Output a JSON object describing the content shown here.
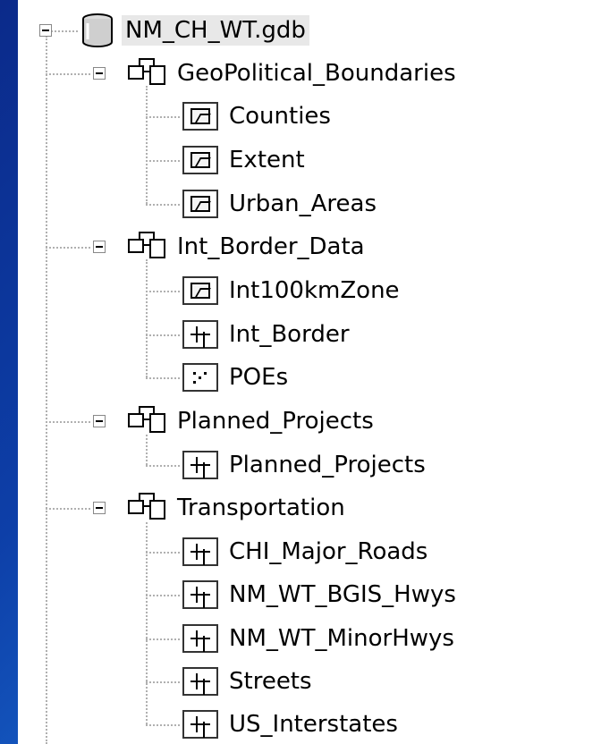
{
  "tree": {
    "root": {
      "label": "NM_CH_WT.gdb",
      "icon": "database-icon"
    },
    "datasets": [
      {
        "label": "GeoPolitical_Boundaries",
        "icon": "feature-dataset-icon",
        "classes": [
          {
            "label": "Counties",
            "type": "polygon"
          },
          {
            "label": "Extent",
            "type": "polygon"
          },
          {
            "label": "Urban_Areas",
            "type": "polygon"
          }
        ]
      },
      {
        "label": "Int_Border_Data",
        "icon": "feature-dataset-icon",
        "classes": [
          {
            "label": "Int100kmZone",
            "type": "polygon"
          },
          {
            "label": "Int_Border",
            "type": "line"
          },
          {
            "label": "POEs",
            "type": "point"
          }
        ]
      },
      {
        "label": "Planned_Projects",
        "icon": "feature-dataset-icon",
        "classes": [
          {
            "label": "Planned_Projects",
            "type": "line"
          }
        ]
      },
      {
        "label": "Transportation",
        "icon": "feature-dataset-icon",
        "classes": [
          {
            "label": "CHI_Major_Roads",
            "type": "line"
          },
          {
            "label": "NM_WT_BGIS_Hwys",
            "type": "line"
          },
          {
            "label": "NM_WT_MinorHwys",
            "type": "line"
          },
          {
            "label": "Streets",
            "type": "line"
          },
          {
            "label": "US_Interstates",
            "type": "line"
          }
        ]
      }
    ]
  }
}
